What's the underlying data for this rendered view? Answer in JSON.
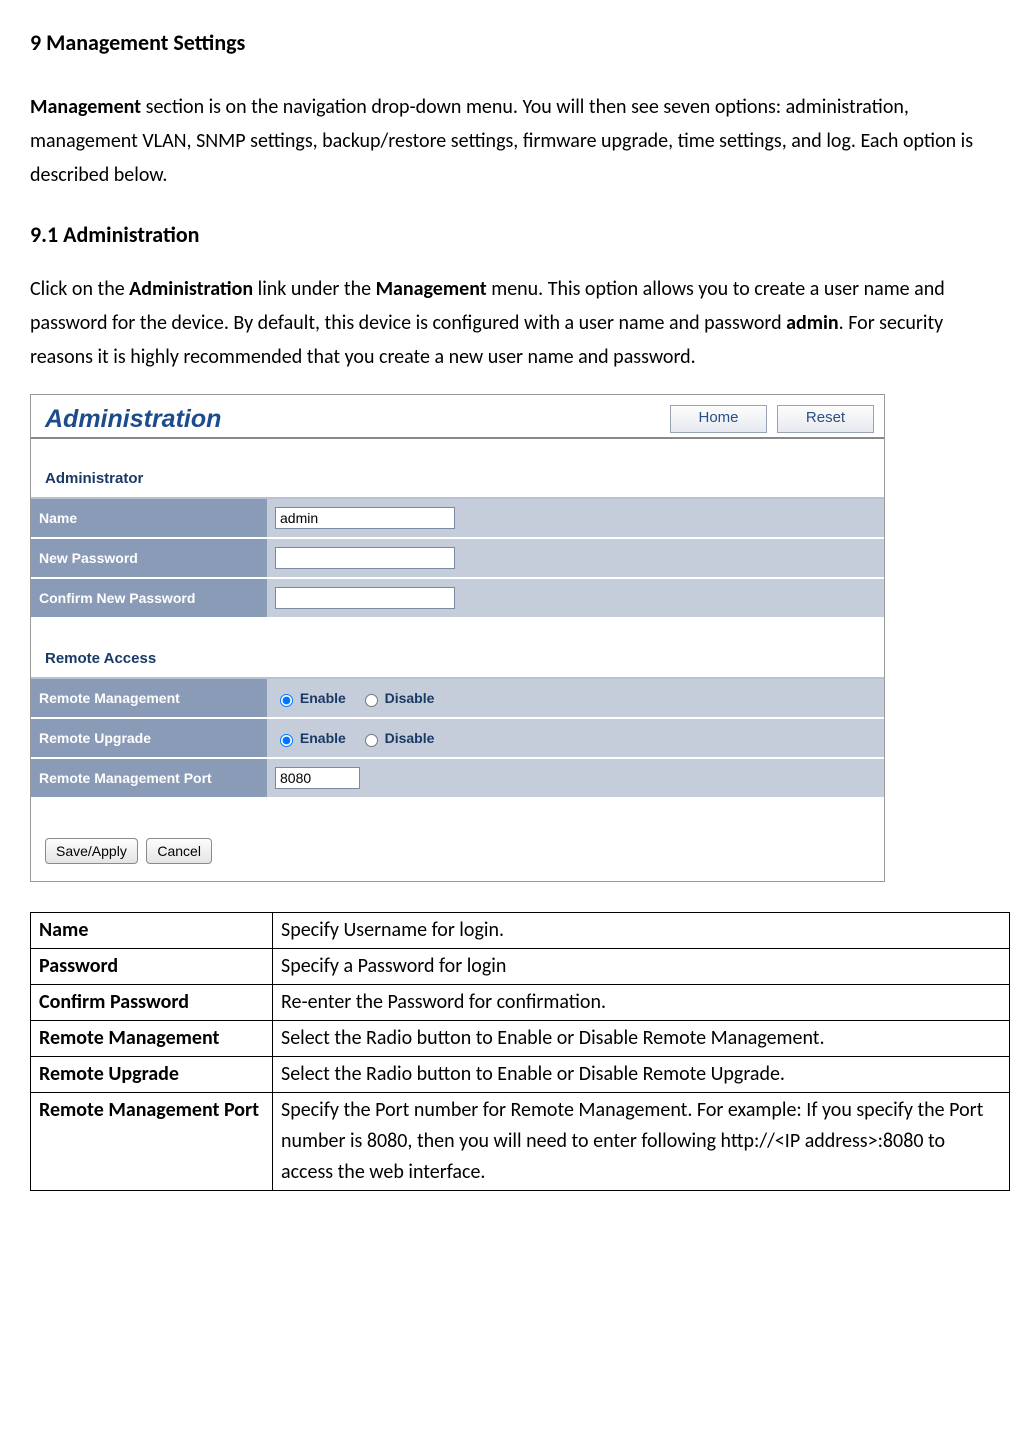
{
  "doc": {
    "h1": "9 Management Settings",
    "intro_prefix_bold": "Management",
    "intro_rest": " section is on the navigation drop-down menu. You will then see seven options: administration, management VLAN, SNMP settings, backup/restore settings, firmware upgrade, time settings, and log. Each option is described below.",
    "h2": "9.1 Administration",
    "p2_a": "Click on the ",
    "p2_b": "Administration",
    "p2_c": " link under the ",
    "p2_d": "Management",
    "p2_e": " menu. This option allows you to create a user name and password for the device. By default, this device is configured with a user name and password ",
    "p2_f": "admin",
    "p2_g": ". For security reasons it is highly recommended that you create a new user name and password."
  },
  "shot": {
    "title": "Administration",
    "btn_home": "Home",
    "btn_reset": "Reset",
    "sec_admin": "Administrator",
    "row_name": "Name",
    "row_newpw": "New Password",
    "row_confpw": "Confirm New Password",
    "name_value": "admin",
    "sec_remote": "Remote Access",
    "row_rmgmt": "Remote Management",
    "row_rupg": "Remote Upgrade",
    "row_rport": "Remote Management Port",
    "enable": "Enable",
    "disable": "Disable",
    "port_value": "8080",
    "btn_save": "Save/Apply",
    "btn_cancel": "Cancel"
  },
  "table": {
    "r1k": "Name",
    "r1v": "Specify Username for login.",
    "r2k": "Password",
    "r2v": "Specify a Password for login",
    "r3k": "Confirm Password",
    "r3v": "Re-enter the Password for confirmation.",
    "r4k": "Remote Management",
    "r4v": "Select the Radio button to Enable or Disable Remote Management.",
    "r5k": "Remote Upgrade",
    "r5v": "Select the Radio button to Enable or Disable Remote Upgrade.",
    "r6k": "Remote Management Port",
    "r6v": "Specify the Port number for Remote Management. For example: If you specify the Port number is 8080, then you will need to enter following http://<IP address>:8080 to access the web interface."
  }
}
